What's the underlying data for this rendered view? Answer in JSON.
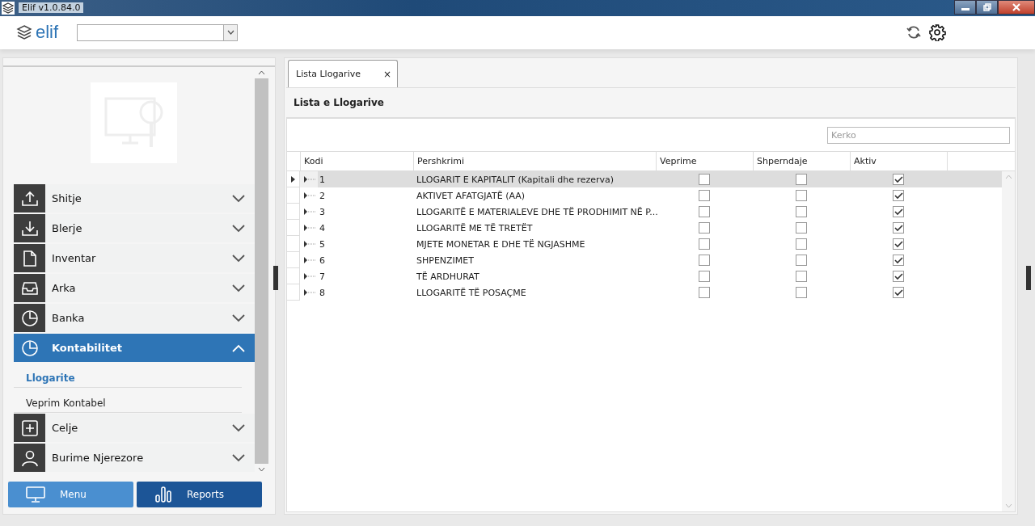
{
  "window": {
    "title": "Elif v1.0.84.0"
  },
  "header": {
    "logo": "elif"
  },
  "sidebar": {
    "items": [
      {
        "label": "Shitje",
        "expanded": false,
        "selected": false
      },
      {
        "label": "Blerje",
        "expanded": false,
        "selected": false
      },
      {
        "label": "Inventar",
        "expanded": false,
        "selected": false
      },
      {
        "label": "Arka",
        "expanded": false,
        "selected": false
      },
      {
        "label": "Banka",
        "expanded": false,
        "selected": false
      },
      {
        "label": "Kontabilitet",
        "expanded": true,
        "selected": true,
        "children": [
          {
            "label": "Llogarite",
            "selected": true
          },
          {
            "label": "Veprim Kontabel",
            "selected": false
          }
        ]
      },
      {
        "label": "Celje",
        "expanded": false,
        "selected": false
      },
      {
        "label": "Burime Njerezore",
        "expanded": false,
        "selected": false
      }
    ],
    "buttons": [
      {
        "label": "Menu",
        "selected": false
      },
      {
        "label": "Reports",
        "selected": true
      }
    ]
  },
  "tabs": [
    {
      "label": "Lista Llogarive",
      "selected": true,
      "close": "×"
    }
  ],
  "panel": {
    "title": "Lista e Llogarive",
    "search": {
      "placeholder": "Kerko"
    }
  },
  "table": {
    "columns": [
      "Kodi",
      "Pershkrimi",
      "Veprime",
      "Shperndaje",
      "Aktiv"
    ],
    "rows": [
      {
        "code": "1",
        "description": "LLOGARIT E KAPITALIT (Kapitali dhe rezerva)",
        "veprime": false,
        "shperndaje": false,
        "aktiv": true,
        "selected": true,
        "expanded": false
      },
      {
        "code": "2",
        "description": "AKTIVET AFATGJATË (AA)",
        "veprime": false,
        "shperndaje": false,
        "aktiv": true,
        "selected": false,
        "expanded": false
      },
      {
        "code": "3",
        "description": "LLOGARITË E MATERIALEVE DHE TË PRODHIMIT NË P...",
        "veprime": false,
        "shperndaje": false,
        "aktiv": true,
        "selected": false,
        "expanded": false
      },
      {
        "code": "4",
        "description": "LLOGARITË ME TË TRETËT",
        "veprime": false,
        "shperndaje": false,
        "aktiv": true,
        "selected": false,
        "expanded": false
      },
      {
        "code": "5",
        "description": "MJETE MONETAR E DHE TË NGJASHME",
        "veprime": false,
        "shperndaje": false,
        "aktiv": true,
        "selected": false,
        "expanded": false
      },
      {
        "code": "6",
        "description": "SHPENZIMET",
        "veprime": false,
        "shperndaje": false,
        "aktiv": true,
        "selected": false,
        "expanded": false
      },
      {
        "code": "7",
        "description": "TË ARDHURAT",
        "veprime": false,
        "shperndaje": false,
        "aktiv": true,
        "selected": false,
        "expanded": false
      },
      {
        "code": "8",
        "description": "LLOGARITË TË POSAÇME",
        "veprime": false,
        "shperndaje": false,
        "aktiv": true,
        "selected": false,
        "expanded": false
      }
    ]
  }
}
